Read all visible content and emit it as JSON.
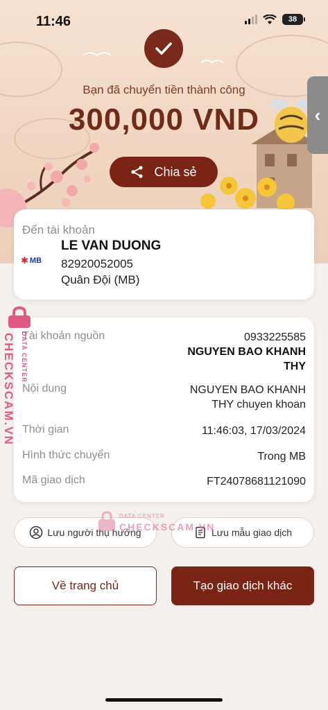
{
  "status": {
    "time": "11:46",
    "battery": "38"
  },
  "hero": {
    "success_text": "Bạn đã chuyển tiền thành công",
    "amount": "300,000 VND",
    "share_label": "Chia sẻ"
  },
  "recipient": {
    "label": "Đến tài khoản",
    "bank_logo": "MB",
    "name": "LE VAN DUONG",
    "account": "82920052005",
    "bank": "Quân Đội (MB)"
  },
  "details": {
    "source_label": "Tài khoản nguồn",
    "source_account": "0933225585",
    "source_name": "NGUYEN BAO KHANH THY",
    "content_label": "Nội dung",
    "content_value": "NGUYEN BAO KHANH THY chuyen khoan",
    "time_label": "Thời gian",
    "time_value": "11:46:03, 17/03/2024",
    "method_label": "Hình thức chuyển",
    "method_value": "Trong MB",
    "txn_label": "Mã giao dịch",
    "txn_value": "FT24078681121090"
  },
  "actions": {
    "save_beneficiary": "Lưu người thụ hưởng",
    "save_template": "Lưu mẫu giao dịch",
    "home": "Về trang chủ",
    "new_txn": "Tạo giao dịch khác"
  },
  "watermark": {
    "text": "CHECKSCAM.VN",
    "sub": "DATA CENTER",
    "text2": "CHECKSCAM.VN"
  },
  "colors": {
    "brand": "#7a2416",
    "hero_bg": "#f1d6c2",
    "watermark": "#e05a86"
  }
}
